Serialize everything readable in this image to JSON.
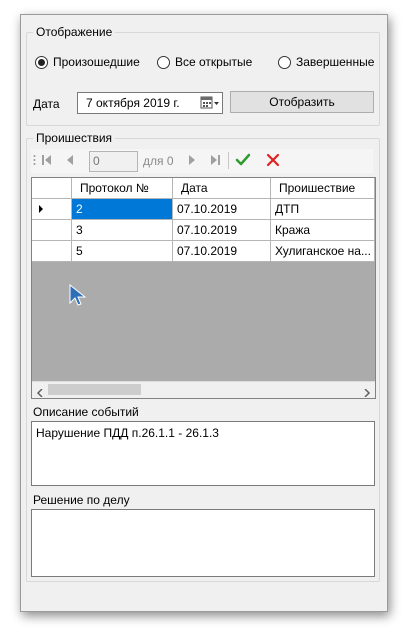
{
  "display_group": {
    "title": "Отображение",
    "radios": [
      {
        "label": "Произошедшие",
        "selected": true
      },
      {
        "label": "Все открытые",
        "selected": false
      },
      {
        "label": "Завершенные",
        "selected": false
      }
    ],
    "date_label": "Дата",
    "date_value": "7 октября  2019 г.",
    "show_button": "Отобразить"
  },
  "incidents_group": {
    "title": "Проишествия",
    "navigator": {
      "position": "0",
      "count_label": "для 0"
    },
    "columns": [
      "Протокол №",
      "Дата",
      "Проишествие"
    ],
    "rows": [
      {
        "protocol": "2",
        "date": "07.10.2019",
        "incident": "ДТП"
      },
      {
        "protocol": "3",
        "date": "07.10.2019",
        "incident": "Кража"
      },
      {
        "protocol": "5",
        "date": "07.10.2019",
        "incident": "Хулиганское на..."
      }
    ]
  },
  "description": {
    "label": "Описание событий",
    "value": "Нарушение ПДД п.26.1.1 - 26.1.3"
  },
  "decision": {
    "label": "Решение по делу",
    "value": ""
  },
  "colors": {
    "window_bg": "#f0f0f0",
    "selected_cell": "#0078d7",
    "grid_empty": "#ababab",
    "confirm_green": "#2e9b2e",
    "cancel_red": "#e02020"
  }
}
